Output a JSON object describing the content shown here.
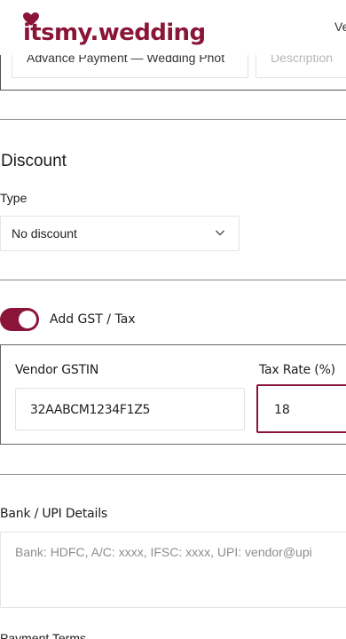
{
  "header": {
    "logo_text": "itsmy.wedding",
    "nav_clip": "Ve"
  },
  "item_row": {
    "description_value": "Advance Payment — Wedding Phot",
    "second_placeholder": "Description"
  },
  "discount": {
    "title": "Discount",
    "type_label": "Type",
    "type_value": "No discount"
  },
  "gst": {
    "toggle_label": "Add GST / Tax",
    "toggle_on": true,
    "vendor_gstin_label": "Vendor GSTIN",
    "vendor_gstin_value": "32AABCM1234F1Z5",
    "tax_rate_label": "Tax Rate (%)",
    "tax_rate_value": "18"
  },
  "bank": {
    "label": "Bank / UPI Details",
    "placeholder": "Bank: HDFC, A/C: xxxx, IFSC: xxxx, UPI: vendor@upi"
  },
  "payment_terms": {
    "label": "Payment Terms"
  },
  "colors": {
    "brand": "#8a1538",
    "border_light": "#e2e2e2",
    "placeholder_text": "#8d8d8d"
  }
}
